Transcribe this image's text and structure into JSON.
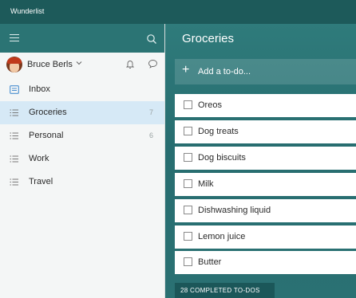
{
  "app": {
    "title": "Wunderlist"
  },
  "sidebar": {
    "user": {
      "name": "Bruce Berls"
    },
    "lists": [
      {
        "label": "Inbox",
        "count": "",
        "icon": "inbox-icon"
      },
      {
        "label": "Groceries",
        "count": "7",
        "icon": "list-icon",
        "active": true
      },
      {
        "label": "Personal",
        "count": "6",
        "icon": "list-icon"
      },
      {
        "label": "Work",
        "count": "",
        "icon": "list-icon"
      },
      {
        "label": "Travel",
        "count": "",
        "icon": "list-icon"
      }
    ]
  },
  "main": {
    "title": "Groceries",
    "add_placeholder": "Add a to-do...",
    "tasks": [
      "Oreos",
      "Dog treats",
      "Dog biscuits",
      "Milk",
      "Dishwashing liquid",
      "Lemon juice",
      "Butter"
    ],
    "completed_label": "28 COMPLETED TO-DOS"
  },
  "colors": {
    "titlebar": "#1d5a5a",
    "header": "#2b7474",
    "accent": "#2f7b7b",
    "active_item": "#d6e9f6"
  }
}
